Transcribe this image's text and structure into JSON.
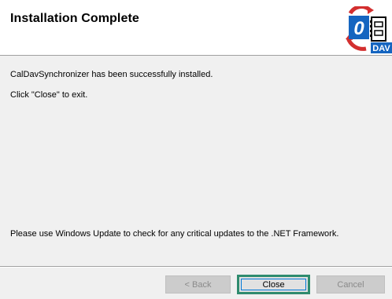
{
  "header": {
    "title": "Installation Complete",
    "logo_text": "DAV",
    "logo_digit": "0"
  },
  "content": {
    "line1": "CalDavSynchronizer has been successfully installed.",
    "line2": "Click \"Close\" to exit.",
    "line3": "Please use Windows Update to check for any critical updates to the .NET Framework."
  },
  "buttons": {
    "back_label": "< Back",
    "close_label": "Close",
    "cancel_label": "Cancel"
  },
  "colors": {
    "logo_blue": "#1565c0",
    "logo_red": "#d32f2f",
    "focus_green": "#2e8b6e"
  }
}
